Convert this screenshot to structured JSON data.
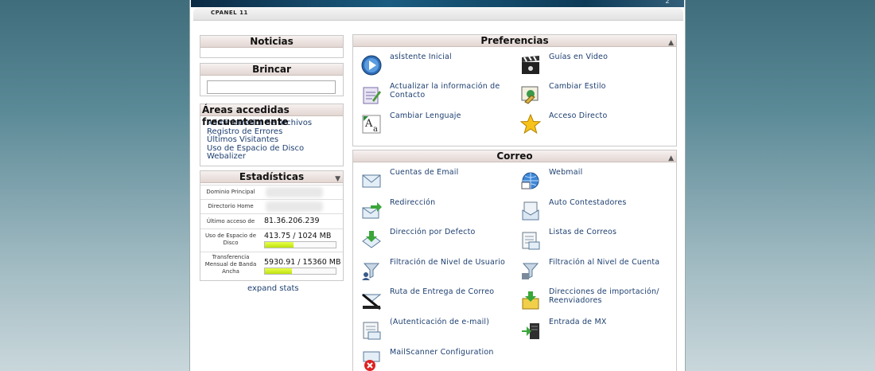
{
  "header": {
    "tab_label": "CPANEL 11"
  },
  "left": {
    "news_title": "Noticias",
    "jump_title": "Brincar",
    "freq_title": "Áreas accedidas frecuentemente",
    "freq_items": [
      "Administrador de Archivos",
      "Registro de Errores",
      "Últimos Visitantes",
      "Uso de Espacio de Disco",
      "Webalizer"
    ],
    "stats_title": "Estadísticas",
    "stats": {
      "domain_label": "Dominio Principal",
      "home_label": "Directorio Home",
      "last_login_label": "Último acceso de",
      "last_login_value": "81.36.206.239",
      "disk_label": "Uso de Espacio de Disco",
      "disk_value": "413.75 / 1024 MB",
      "disk_fraction": 0.404,
      "bandwidth_label": "Transferencia Mensual de Banda Ancha",
      "bandwidth_value": "5930.91 / 15360 MB",
      "bandwidth_fraction": 0.386
    },
    "expand_label": "expand stats"
  },
  "preferences": {
    "title": "Preferencias",
    "items": [
      {
        "label": "asÍstente Inicial",
        "icon": "play-icon"
      },
      {
        "label": "Guías en Video",
        "icon": "clapperboard-icon"
      },
      {
        "label": "Actualizar la información de Contacto",
        "icon": "contact-card-icon"
      },
      {
        "label": "Cambiar Estilo",
        "icon": "paint-style-icon"
      },
      {
        "label": "Cambiar Lenguaje",
        "icon": "language-icon"
      },
      {
        "label": "Acceso Directo",
        "icon": "star-icon"
      }
    ]
  },
  "mail": {
    "title": "Correo",
    "items": [
      {
        "label": "Cuentas de Email",
        "icon": "envelope-icon"
      },
      {
        "label": "Webmail",
        "icon": "globe-mail-icon"
      },
      {
        "label": "Redirección",
        "icon": "forward-mail-icon"
      },
      {
        "label": "Auto Contestadores",
        "icon": "autoresponder-icon"
      },
      {
        "label": "Dirección por Defecto",
        "icon": "default-address-icon"
      },
      {
        "label": "Listas de Correos",
        "icon": "mailing-list-icon"
      },
      {
        "label": "Filtración de Nivel de Usuario",
        "icon": "user-filter-icon"
      },
      {
        "label": "Filtración al Nivel de Cuenta",
        "icon": "account-filter-icon"
      },
      {
        "label": "Ruta de Entrega de Correo",
        "icon": "delivery-route-icon"
      },
      {
        "label": "Direcciones de importación/ Reenviadores",
        "icon": "import-addresses-icon"
      },
      {
        "label": "(Autenticación de e-mail)",
        "icon": "email-auth-icon"
      },
      {
        "label": "Entrada de MX",
        "icon": "mx-entry-icon"
      },
      {
        "label": "MailScanner Configuration",
        "icon": "mailscanner-icon"
      }
    ]
  }
}
